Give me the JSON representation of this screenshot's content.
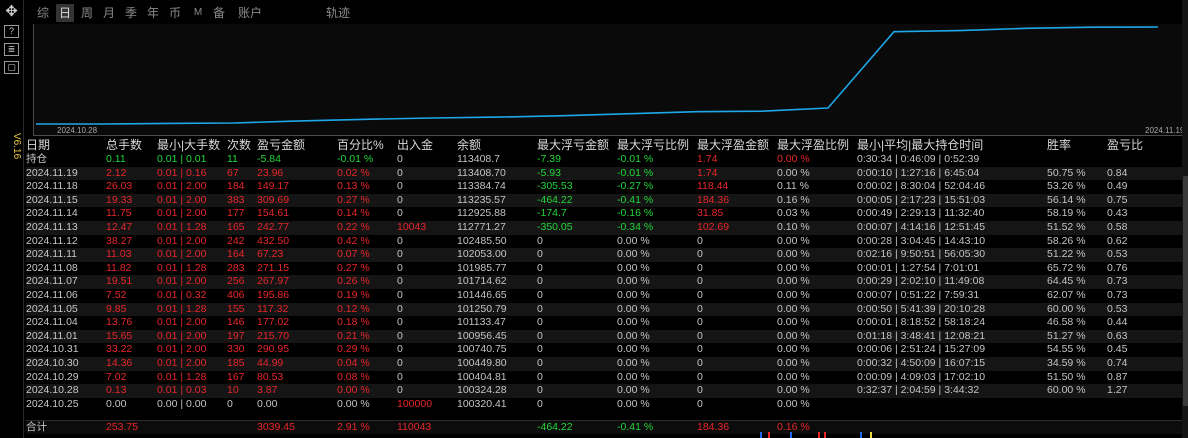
{
  "toolbar": {
    "icons": [
      "move-icon",
      "help-icon",
      "dashboard-icon",
      "window-icon"
    ],
    "help_label": "?",
    "dash_label": "≣",
    "win_label": "▢",
    "move_label": "✥",
    "version": "V6.16"
  },
  "tabs": [
    {
      "label": "综"
    },
    {
      "label": "日"
    },
    {
      "label": "周"
    },
    {
      "label": "月"
    },
    {
      "label": "季"
    },
    {
      "label": "年"
    },
    {
      "label": "币"
    },
    {
      "label": "M"
    },
    {
      "label": "备"
    },
    {
      "label": "账户"
    },
    {
      "label": "轨迹"
    }
  ],
  "chart": {
    "start_date": "2024.10.28",
    "end_date": "2024.11.19",
    "line_color": "#1ea8e8"
  },
  "chart_data": {
    "type": "line",
    "x": [
      "2024.10.25",
      "2024.10.28",
      "2024.10.29",
      "2024.10.30",
      "2024.10.31",
      "2024.11.01",
      "2024.11.04",
      "2024.11.05",
      "2024.11.06",
      "2024.11.07",
      "2024.11.08",
      "2024.11.11",
      "2024.11.12",
      "2024.11.13",
      "2024.11.14",
      "2024.11.15",
      "2024.11.18",
      "2024.11.19"
    ],
    "series": [
      {
        "values": [
          100320.41,
          100324.28,
          100404.81,
          100449.8,
          100740.75,
          100956.45,
          101133.47,
          101250.79,
          101446.65,
          101714.62,
          101985.77,
          102053.0,
          102485.5,
          112771.27,
          112925.88,
          113235.57,
          113384.74,
          113408.7
        ]
      }
    ]
  },
  "table": {
    "headers": [
      "日期",
      "总手数",
      "最小|大手数",
      "次数",
      "盈亏金额",
      "百分比%",
      "出入金",
      "余额",
      "最大浮亏金额",
      "最大浮亏比例",
      "最大浮盈金额",
      "最大浮盈比例",
      "最小|平均|最大持仓时间",
      "胜率",
      "盈亏比"
    ],
    "holding": {
      "date": "持仓",
      "lots": "0.11",
      "minmax": "0.01 | 0.01",
      "count": "11",
      "pnl": "-5.84",
      "pct": "-0.01 %",
      "flow": "0",
      "balance": "113408.7",
      "maxloss": "-7.39",
      "maxloss_pct": "-0.01 %",
      "maxprofit": "1.74",
      "maxprofit_pct": "0.00 %",
      "hold": "0:30:34 | 0:46:09 | 0:52:39",
      "winrate": "",
      "pf": ""
    },
    "rows": [
      {
        "date": "2024.11.19",
        "lots": "2.12",
        "minmax": "0.01 | 0.16",
        "count": "67",
        "pnl": "23.96",
        "pct": "0.02 %",
        "flow": "0",
        "balance": "113408.70",
        "maxloss": "-5.93",
        "maxloss_pct": "-0.01 %",
        "maxprofit": "1.74",
        "maxprofit_pct": "0.00 %",
        "hold": "0:00:10 | 1:27:16 | 6:45:04",
        "winrate": "50.75 %",
        "pf": "0.84"
      },
      {
        "date": "2024.11.18",
        "lots": "26.03",
        "minmax": "0.01 | 2.00",
        "count": "184",
        "pnl": "149.17",
        "pct": "0.13 %",
        "flow": "0",
        "balance": "113384.74",
        "maxloss": "-305.53",
        "maxloss_pct": "-0.27 %",
        "maxprofit": "118.44",
        "maxprofit_pct": "0.11 %",
        "hold": "0:00:02 | 8:30:04 | 52:04:46",
        "winrate": "53.26 %",
        "pf": "0.49"
      },
      {
        "date": "2024.11.15",
        "lots": "19.33",
        "minmax": "0.01 | 2.00",
        "count": "383",
        "pnl": "309.69",
        "pct": "0.27 %",
        "flow": "0",
        "balance": "113235.57",
        "maxloss": "-464.22",
        "maxloss_pct": "-0.41 %",
        "maxprofit": "184.36",
        "maxprofit_pct": "0.16 %",
        "hold": "0:00:05 | 2:17:23 | 15:51:03",
        "winrate": "56.14 %",
        "pf": "0.75"
      },
      {
        "date": "2024.11.14",
        "lots": "11.75",
        "minmax": "0.01 | 2.00",
        "count": "177",
        "pnl": "154.61",
        "pct": "0.14 %",
        "flow": "0",
        "balance": "112925.88",
        "maxloss": "-174.7",
        "maxloss_pct": "-0.16 %",
        "maxprofit": "31.85",
        "maxprofit_pct": "0.03 %",
        "hold": "0:00:49 | 2:29:13 | 11:32:40",
        "winrate": "58.19 %",
        "pf": "0.43"
      },
      {
        "date": "2024.11.13",
        "lots": "12.47",
        "minmax": "0.01 | 1.28",
        "count": "165",
        "pnl": "242.77",
        "pct": "0.22 %",
        "flow": "10043",
        "balance": "112771.27",
        "maxloss": "-350.05",
        "maxloss_pct": "-0.34 %",
        "maxprofit": "102.69",
        "maxprofit_pct": "0.10 %",
        "hold": "0:00:07 | 4:14:16 | 12:51:45",
        "winrate": "51.52 %",
        "pf": "0.58"
      },
      {
        "date": "2024.11.12",
        "lots": "38.27",
        "minmax": "0.01 | 2.00",
        "count": "242",
        "pnl": "432.50",
        "pct": "0.42 %",
        "flow": "0",
        "balance": "102485.50",
        "maxloss": "0",
        "maxloss_pct": "0.00 %",
        "maxprofit": "0",
        "maxprofit_pct": "0.00 %",
        "hold": "0:00:28 | 3:04:45 | 14:43:10",
        "winrate": "58.26 %",
        "pf": "0.62"
      },
      {
        "date": "2024.11.11",
        "lots": "11.03",
        "minmax": "0.01 | 2.00",
        "count": "164",
        "pnl": "67.23",
        "pct": "0.07 %",
        "flow": "0",
        "balance": "102053.00",
        "maxloss": "0",
        "maxloss_pct": "0.00 %",
        "maxprofit": "0",
        "maxprofit_pct": "0.00 %",
        "hold": "0:02:16 | 9:50:51 | 56:05:30",
        "winrate": "51.22 %",
        "pf": "0.53"
      },
      {
        "date": "2024.11.08",
        "lots": "11.82",
        "minmax": "0.01 | 1.28",
        "count": "283",
        "pnl": "271.15",
        "pct": "0.27 %",
        "flow": "0",
        "balance": "101985.77",
        "maxloss": "0",
        "maxloss_pct": "0.00 %",
        "maxprofit": "0",
        "maxprofit_pct": "0.00 %",
        "hold": "0:00:01 | 1:27:54 | 7:01:01",
        "winrate": "65.72 %",
        "pf": "0.76"
      },
      {
        "date": "2024.11.07",
        "lots": "19.51",
        "minmax": "0.01 | 2.00",
        "count": "256",
        "pnl": "267.97",
        "pct": "0.26 %",
        "flow": "0",
        "balance": "101714.62",
        "maxloss": "0",
        "maxloss_pct": "0.00 %",
        "maxprofit": "0",
        "maxprofit_pct": "0.00 %",
        "hold": "0:00:29 | 2:02:10 | 11:49:08",
        "winrate": "64.45 %",
        "pf": "0.73"
      },
      {
        "date": "2024.11.06",
        "lots": "7.52",
        "minmax": "0.01 | 0.32",
        "count": "406",
        "pnl": "195.86",
        "pct": "0.19 %",
        "flow": "0",
        "balance": "101446.65",
        "maxloss": "0",
        "maxloss_pct": "0.00 %",
        "maxprofit": "0",
        "maxprofit_pct": "0.00 %",
        "hold": "0:00:07 | 0:51:22 | 7:59:31",
        "winrate": "62.07 %",
        "pf": "0.73"
      },
      {
        "date": "2024.11.05",
        "lots": "9.85",
        "minmax": "0.01 | 1.28",
        "count": "155",
        "pnl": "117.32",
        "pct": "0.12 %",
        "flow": "0",
        "balance": "101250.79",
        "maxloss": "0",
        "maxloss_pct": "0.00 %",
        "maxprofit": "0",
        "maxprofit_pct": "0.00 %",
        "hold": "0:00:50 | 5:41:39 | 20:10:28",
        "winrate": "60.00 %",
        "pf": "0.53"
      },
      {
        "date": "2024.11.04",
        "lots": "13.76",
        "minmax": "0.01 | 2.00",
        "count": "146",
        "pnl": "177.02",
        "pct": "0.18 %",
        "flow": "0",
        "balance": "101133.47",
        "maxloss": "0",
        "maxloss_pct": "0.00 %",
        "maxprofit": "0",
        "maxprofit_pct": "0.00 %",
        "hold": "0:00:01 | 8:18:52 | 58:18:24",
        "winrate": "46.58 %",
        "pf": "0.44"
      },
      {
        "date": "2024.11.01",
        "lots": "15.65",
        "minmax": "0.01 | 2.00",
        "count": "197",
        "pnl": "215.70",
        "pct": "0.21 %",
        "flow": "0",
        "balance": "100956.45",
        "maxloss": "0",
        "maxloss_pct": "0.00 %",
        "maxprofit": "0",
        "maxprofit_pct": "0.00 %",
        "hold": "0:01:18 | 3:48:41 | 12:08:21",
        "winrate": "51.27 %",
        "pf": "0.63"
      },
      {
        "date": "2024.10.31",
        "lots": "33.22",
        "minmax": "0.01 | 2.00",
        "count": "330",
        "pnl": "290.95",
        "pct": "0.29 %",
        "flow": "0",
        "balance": "100740.75",
        "maxloss": "0",
        "maxloss_pct": "0.00 %",
        "maxprofit": "0",
        "maxprofit_pct": "0.00 %",
        "hold": "0:00:06 | 2:51:24 | 15:27:09",
        "winrate": "54.55 %",
        "pf": "0.45"
      },
      {
        "date": "2024.10.30",
        "lots": "14.36",
        "minmax": "0.01 | 2.00",
        "count": "185",
        "pnl": "44.99",
        "pct": "0.04 %",
        "flow": "0",
        "balance": "100449.80",
        "maxloss": "0",
        "maxloss_pct": "0.00 %",
        "maxprofit": "0",
        "maxprofit_pct": "0.00 %",
        "hold": "0:00:32 | 4:50:09 | 16:07:15",
        "winrate": "34.59 %",
        "pf": "0.74"
      },
      {
        "date": "2024.10.29",
        "lots": "7.02",
        "minmax": "0.01 | 1.28",
        "count": "167",
        "pnl": "80.53",
        "pct": "0.08 %",
        "flow": "0",
        "balance": "100404.81",
        "maxloss": "0",
        "maxloss_pct": "0.00 %",
        "maxprofit": "0",
        "maxprofit_pct": "0.00 %",
        "hold": "0:00:09 | 4:09:03 | 17:02:10",
        "winrate": "51.50 %",
        "pf": "0.87"
      },
      {
        "date": "2024.10.28",
        "lots": "0.13",
        "minmax": "0.01 | 0.03",
        "count": "10",
        "pnl": "3.87",
        "pct": "0.00 %",
        "flow": "0",
        "balance": "100324.28",
        "maxloss": "0",
        "maxloss_pct": "0.00 %",
        "maxprofit": "0",
        "maxprofit_pct": "0.00 %",
        "hold": "0:32:37 | 2:04:59 | 3:44:32",
        "winrate": "60.00 %",
        "pf": "1.27"
      },
      {
        "date": "2024.10.25",
        "lots": "0.00",
        "minmax": "0.00 | 0.00",
        "count": "0",
        "pnl": "0.00",
        "pct": "0.00 %",
        "flow": "100000",
        "balance": "100320.41",
        "maxloss": "0",
        "maxloss_pct": "0.00 %",
        "maxprofit": "0",
        "maxprofit_pct": "0.00 %",
        "hold": "",
        "winrate": "",
        "pf": ""
      }
    ],
    "summary": {
      "label": "合计",
      "lots": "253.75",
      "pnl": "3039.45",
      "pct": "2.91 %",
      "flow": "110043",
      "maxloss": "-464.22",
      "maxloss_pct": "-0.41 %",
      "maxprofit": "184.36",
      "maxprofit_pct": "0.16 %"
    }
  },
  "colors": {
    "red": "#e8262a",
    "green": "#22d63a",
    "yellow": "#e8d84a",
    "line": "#1ea8e8"
  }
}
